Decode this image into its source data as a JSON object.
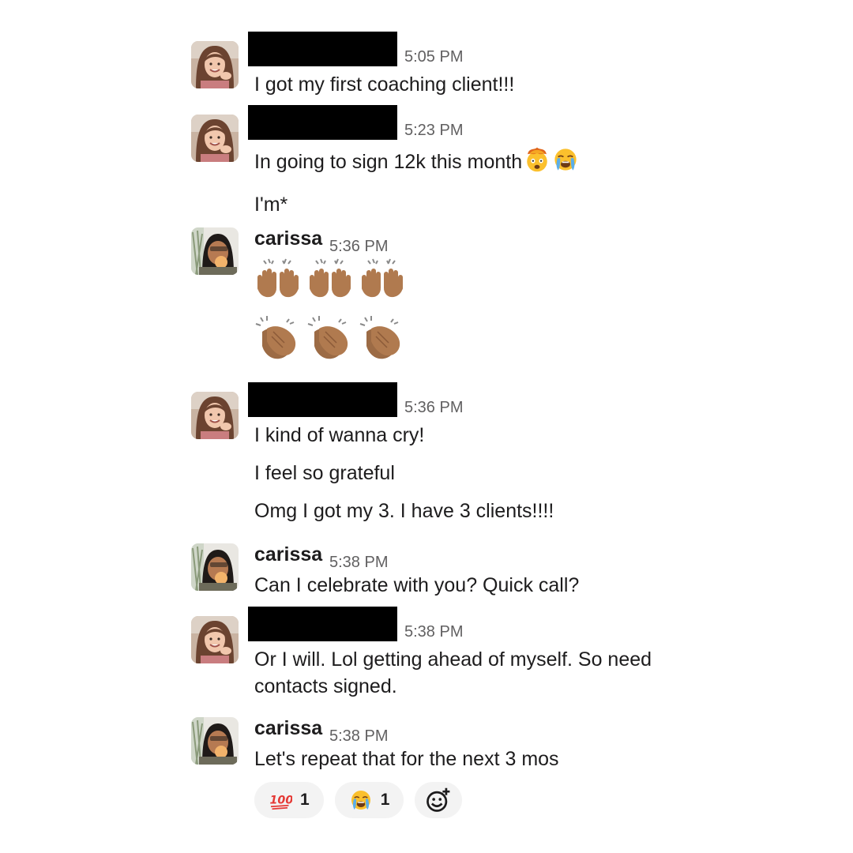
{
  "messages": [
    {
      "author": "",
      "avatar": "avatar-woman",
      "time": "5:05 PM",
      "lines": [
        "I got my first coaching client!!!"
      ]
    },
    {
      "author": "",
      "avatar": "avatar-woman",
      "time": "5:23 PM",
      "lines": [
        "In going to sign 12k this month",
        "I'm*"
      ],
      "inline_emoji": [
        "exploding-head-icon",
        "loudly-crying-icon"
      ]
    },
    {
      "author": "carissa",
      "avatar": "avatar-carissa",
      "time": "5:36 PM",
      "emoji_rows": [
        [
          "raising-hands-icon",
          "raising-hands-icon",
          "raising-hands-icon"
        ],
        [
          "clapping-hands-icon",
          "clapping-hands-icon",
          "clapping-hands-icon"
        ]
      ]
    },
    {
      "author": "",
      "avatar": "avatar-woman",
      "time": "5:36 PM",
      "lines": [
        "I kind of wanna cry!",
        "I feel so grateful",
        "Omg I got my 3. I have 3 clients!!!!"
      ]
    },
    {
      "author": "carissa",
      "avatar": "avatar-carissa",
      "time": "5:38 PM",
      "lines": [
        "Can I celebrate with you? Quick call?"
      ]
    },
    {
      "author": "",
      "avatar": "avatar-woman",
      "time": "5:38 PM",
      "lines": [
        "Or I will. Lol getting ahead of myself. So need",
        "contacts signed."
      ]
    },
    {
      "author": "carissa",
      "avatar": "avatar-carissa",
      "time": "5:38 PM",
      "lines": [
        "Let's repeat that for the next 3 mos"
      ]
    }
  ],
  "reactions": [
    {
      "emoji": "hundred-points-icon",
      "count": "1"
    },
    {
      "emoji": "loudly-crying-icon",
      "count": "1"
    },
    {
      "emoji": "add-reaction-icon",
      "count": ""
    }
  ],
  "colors": {
    "timestamp": "#616061",
    "reaction_bg": "#f3f3f3",
    "redaction": "#000000",
    "skin": "#b07a4f"
  }
}
